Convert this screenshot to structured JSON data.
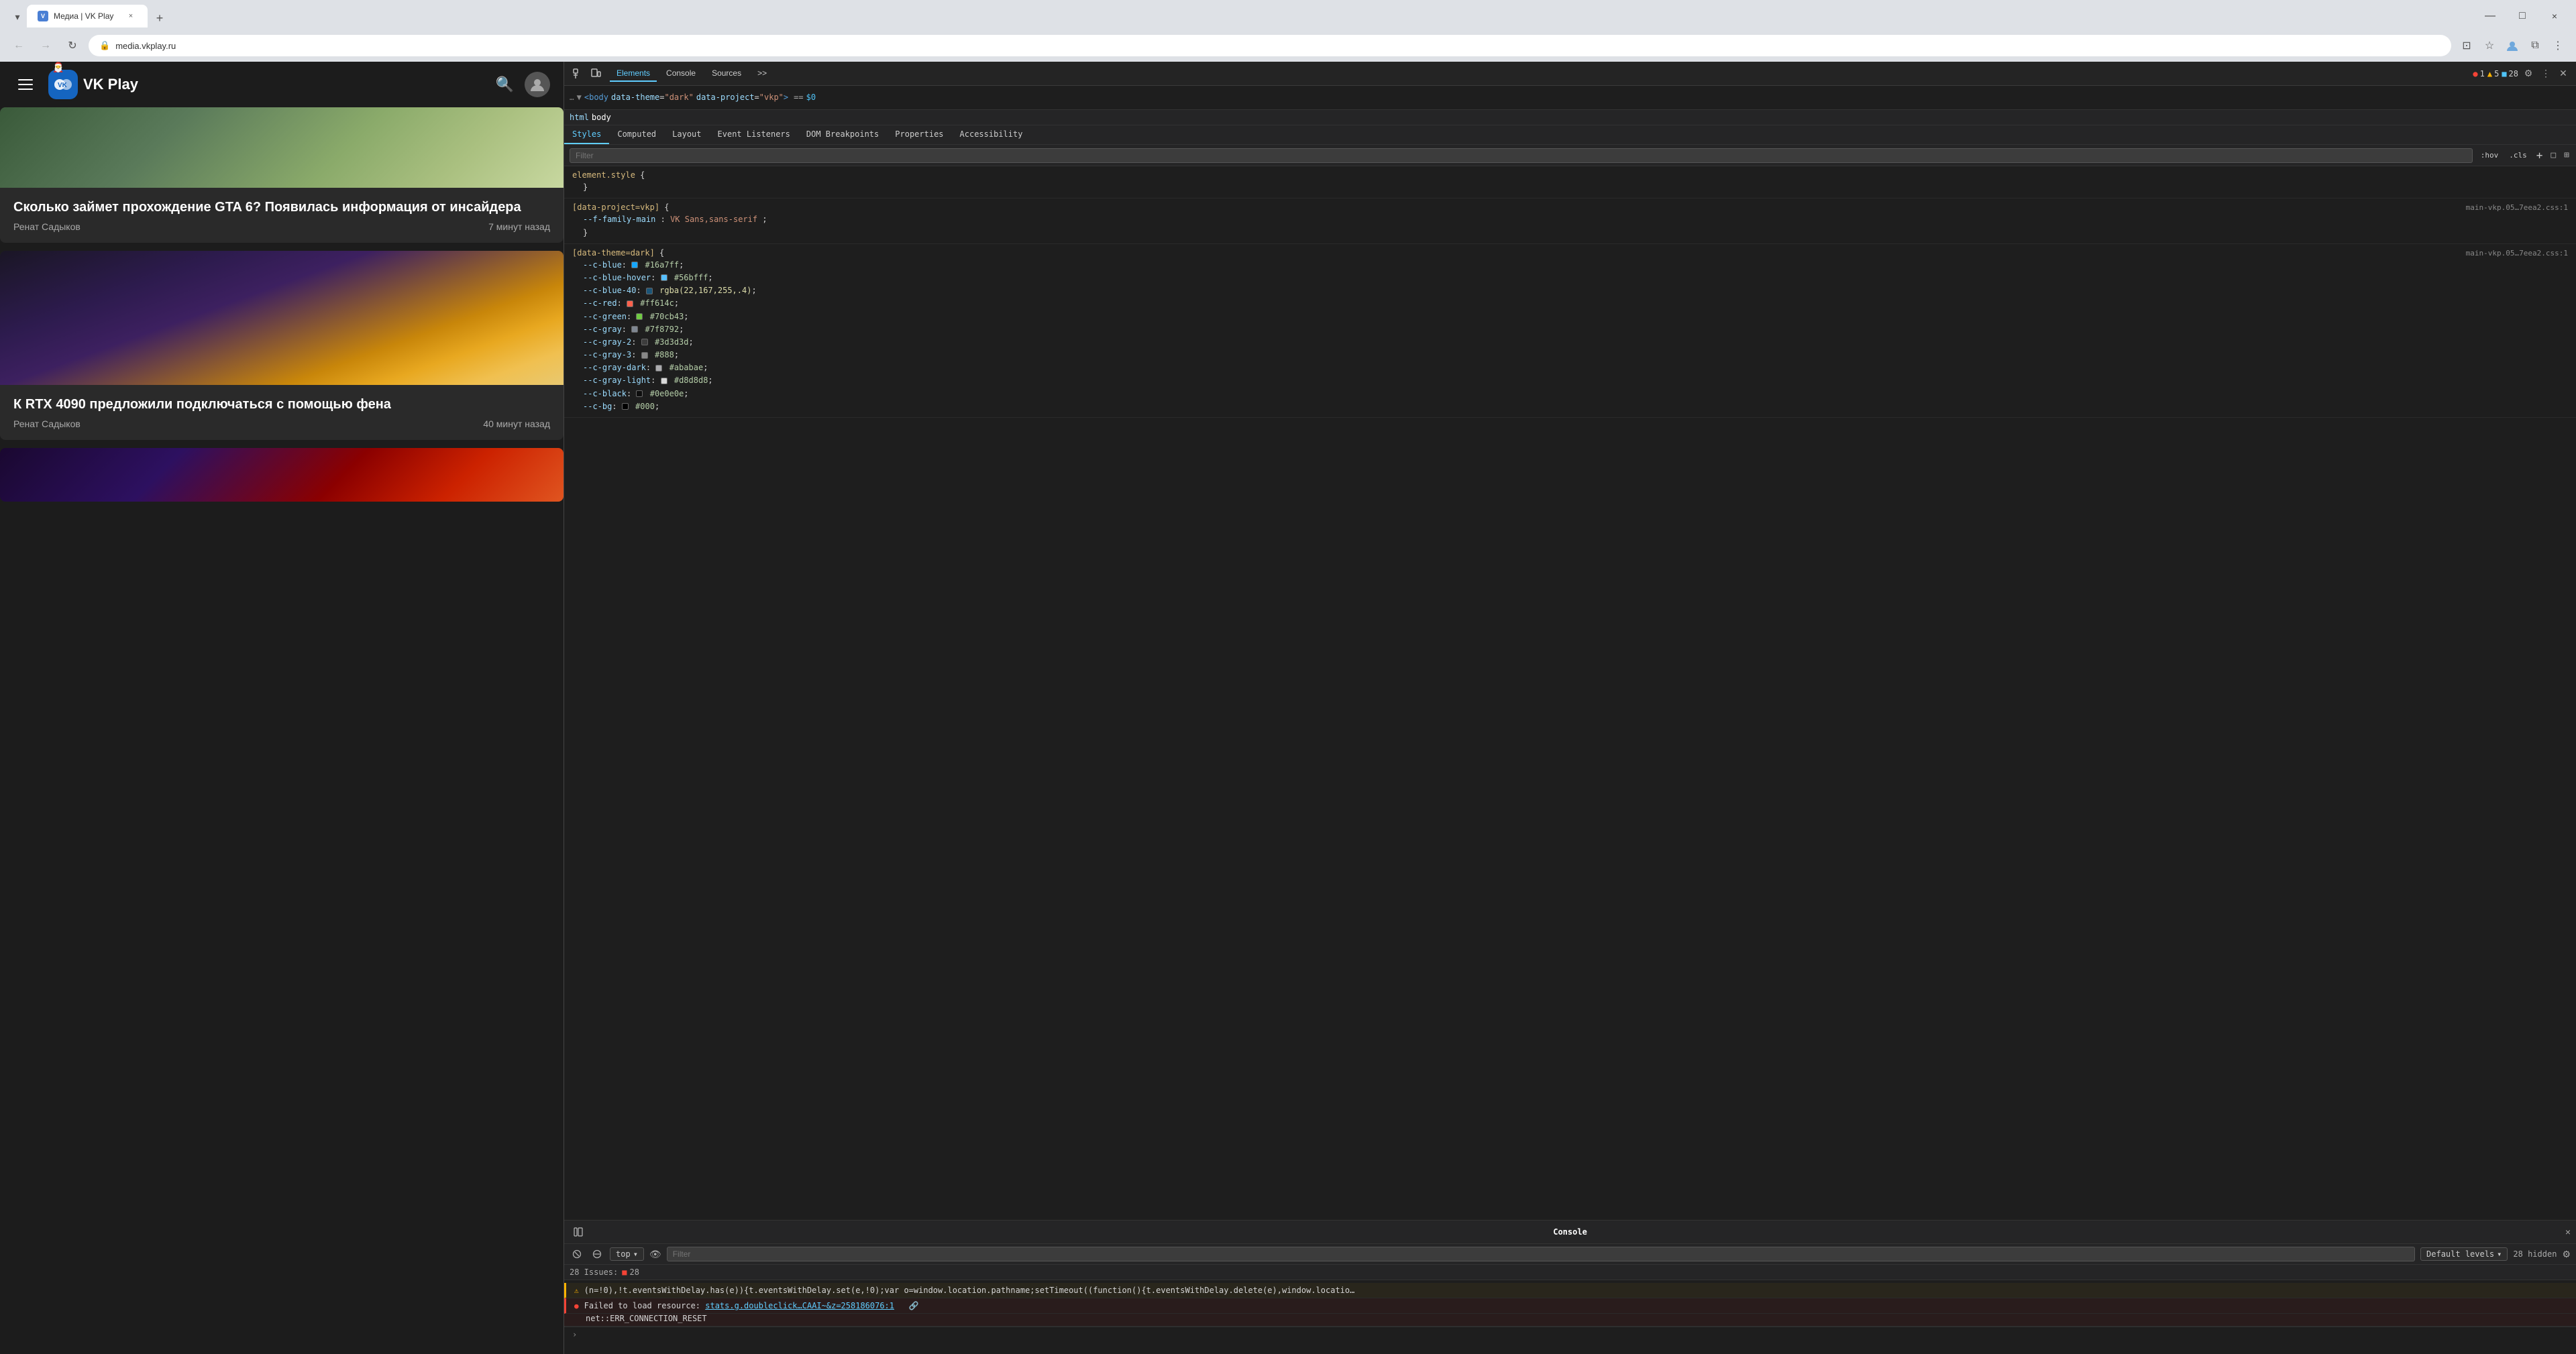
{
  "browser": {
    "tab": {
      "title": "Медиа | VK Play",
      "favicon_label": "VK",
      "close_label": "×"
    },
    "new_tab_label": "+",
    "controls": {
      "minimize": "—",
      "maximize": "□",
      "close": "×"
    },
    "nav": {
      "back": "←",
      "forward": "→",
      "refresh": "↻"
    },
    "address": "media.vkplay.ru",
    "toolbar_icons": {
      "cast": "⊡",
      "bookmark": "☆",
      "profile": "👤",
      "extensions": "⧉",
      "menu": "⋮"
    }
  },
  "vkplay": {
    "logo_text": "VK Play",
    "articles": [
      {
        "id": "gta6",
        "image_class": "img-gta",
        "title": "Сколько займет прохождение GTA 6? Появилась информация от инсайдера",
        "author": "Ренат Садыков",
        "time": "7 минут назад"
      },
      {
        "id": "rtx4090",
        "image_class": "img-rtx",
        "title": "К RTX 4090 предложили подключаться с помощью фена",
        "author": "Ренат Садыков",
        "time": "40 минут назад"
      },
      {
        "id": "game3",
        "image_class": "img-game",
        "title": "",
        "author": "",
        "time": ""
      }
    ]
  },
  "devtools": {
    "tabs": [
      "Elements",
      "Console",
      "Sources"
    ],
    "more_label": ">>",
    "issue_counts": {
      "errors": "1",
      "warnings": "5",
      "info": "28"
    },
    "dom": {
      "line1": "... ▼ <body data-theme=\"dark\" data-project=\"vkp\"> == $0",
      "breadcrumb_html": "html",
      "breadcrumb_body": "body"
    },
    "styles": {
      "filter_placeholder": "Filter",
      "hov_label": ":hov",
      "cls_label": ".cls",
      "plus_label": "+",
      "layout_icon": "□",
      "grid_icon": "⊞",
      "tabs": [
        "Styles",
        "Computed",
        "Layout",
        "Event Listeners",
        "DOM Breakpoints",
        "Properties",
        "Accessibility"
      ],
      "rules": [
        {
          "selector": "element.style",
          "source": "",
          "properties": []
        },
        {
          "selector": "[data-project=vkp]",
          "source": "main-vkp.05…7eea2.css:1",
          "properties": [
            {
              "name": "--f-family-main",
              "value": "VK Sans,sans-serif",
              "color": null
            }
          ]
        },
        {
          "selector": "[data-theme=dark]",
          "source": "main-vkp.05…7eea2.css:1",
          "properties": [
            {
              "name": "--c-blue",
              "value": "#16a7ff",
              "color": "#16a7ff"
            },
            {
              "name": "--c-blue-hover",
              "value": "#56bfff",
              "color": "#56bfff"
            },
            {
              "name": "--c-blue-40",
              "value": "rgba(22,167,255,.4)",
              "color": "rgba(22,167,255,0.4)"
            },
            {
              "name": "--c-red",
              "value": "#ff614c",
              "color": "#ff614c"
            },
            {
              "name": "--c-green",
              "value": "#70cb43",
              "color": "#70cb43"
            },
            {
              "name": "--c-gray",
              "value": "#7f8792",
              "color": "#7f8792"
            },
            {
              "name": "--c-gray-2",
              "value": "#3d3d3d",
              "color": "#3d3d3d"
            },
            {
              "name": "--c-gray-3",
              "value": "#888",
              "color": "#888888"
            },
            {
              "name": "--c-gray-dark",
              "value": "#ababae",
              "color": "#ababae"
            },
            {
              "name": "--c-gray-light",
              "value": "#d8d8d8",
              "color": "#d8d8d8"
            },
            {
              "name": "--c-black",
              "value": "#0e0e0e",
              "color": "#0e0e0e"
            },
            {
              "name": "--c-bg",
              "value": "#000",
              "color": "#000000"
            }
          ]
        }
      ]
    },
    "console": {
      "title": "Console",
      "close_label": "×",
      "top_label": "top",
      "filter_placeholder": "Filter",
      "default_levels": "Default levels",
      "hidden_count": "28 hidden",
      "issues_count": "28 Issues:",
      "issues_count_num": "28",
      "messages": [
        {
          "type": "warning",
          "icon": "⚠",
          "text": "(n=!0),!t.eventsWithDelay.has(e)){t.eventsWithDelay.set(e,!0);var o=window.location.pathname;setTimeout((function(){t.eventsWithDelay.delete(e),window.locatio…",
          "link": null
        },
        {
          "type": "error",
          "icon": "✕",
          "text": "Failed to load resource: net::ERR_CONNECTION_RESET",
          "link": "stats.g.doubleclick…CAAI~&z=258186076:1"
        }
      ],
      "arrow_label": "›"
    }
  }
}
